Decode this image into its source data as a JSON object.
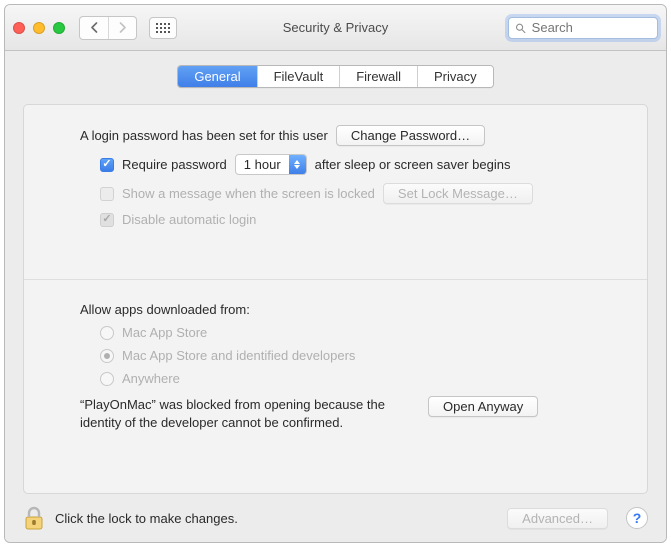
{
  "window": {
    "title": "Security & Privacy"
  },
  "search": {
    "placeholder": "Search"
  },
  "tabs": {
    "general": "General",
    "filevault": "FileVault",
    "firewall": "Firewall",
    "privacy": "Privacy"
  },
  "login_section": {
    "password_set_text": "A login password has been set for this user",
    "change_password_btn": "Change Password…",
    "require_password_label": "Require password",
    "require_password_duration": "1 hour",
    "require_password_suffix": "after sleep or screen saver begins",
    "show_message_label": "Show a message when the screen is locked",
    "set_lock_message_btn": "Set Lock Message…",
    "disable_auto_login_label": "Disable automatic login"
  },
  "allow_section": {
    "heading": "Allow apps downloaded from:",
    "option_appstore": "Mac App Store",
    "option_identified": "Mac App Store and identified developers",
    "option_anywhere": "Anywhere",
    "blocked_message": "“PlayOnMac” was blocked from opening because the identity of the developer cannot be confirmed.",
    "open_anyway_btn": "Open Anyway"
  },
  "footer": {
    "lock_text": "Click the lock to make changes.",
    "advanced_btn": "Advanced…"
  }
}
